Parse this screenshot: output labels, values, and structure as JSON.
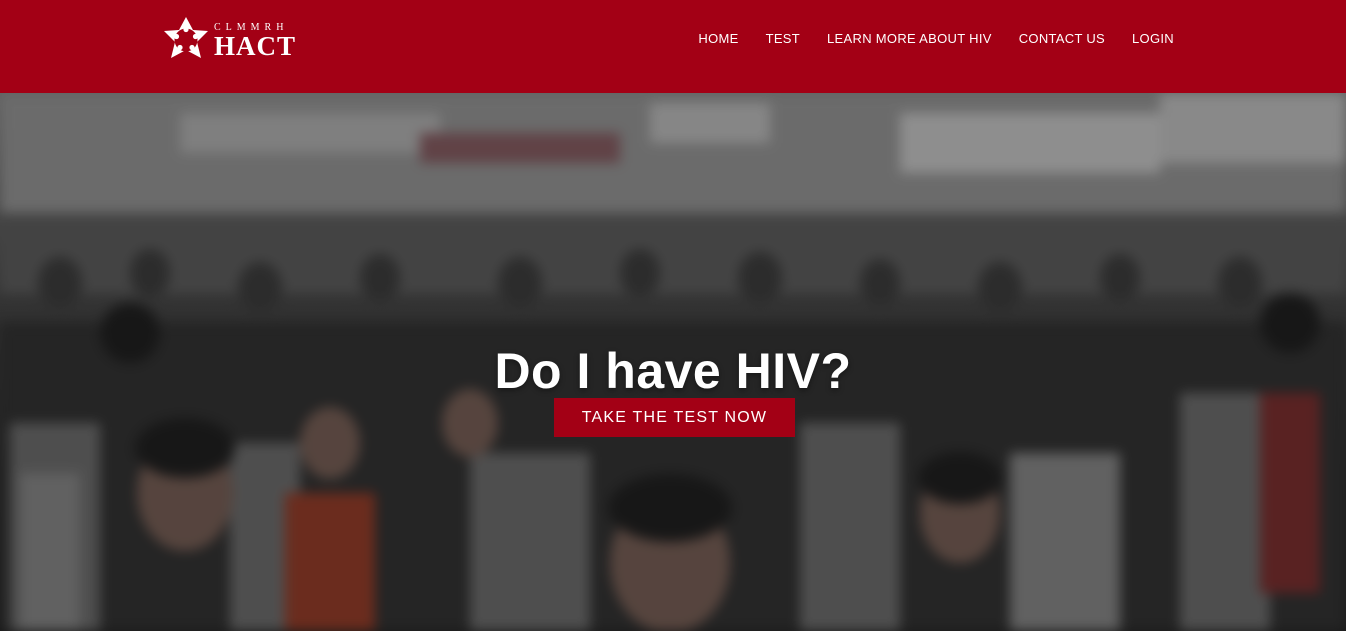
{
  "header": {
    "brand_small": "CLMMRH",
    "brand_big": "HACT",
    "logo_icon": "star-ring-logo",
    "bg_color": "#a30015"
  },
  "nav": {
    "items": [
      {
        "label": "HOME"
      },
      {
        "label": "TEST"
      },
      {
        "label": "LEARN MORE ABOUT HIV"
      },
      {
        "label": "CONTACT US"
      },
      {
        "label": "LOGIN"
      }
    ]
  },
  "hero": {
    "title": "Do I have HIV?",
    "cta_label": "TAKE THE TEST NOW",
    "cta_color": "#a30015",
    "background": "blurred-crowd-photo"
  }
}
